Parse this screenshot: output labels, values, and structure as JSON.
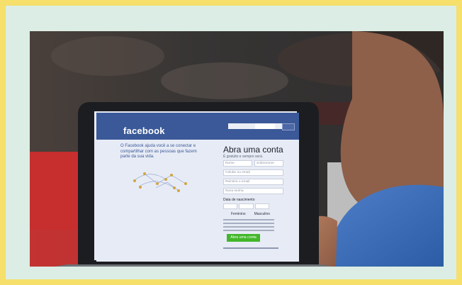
{
  "facebook": {
    "brand": "facebook",
    "intro": "O Facebook ajuda você a se conectar e compartilhar com as pessoas que fazem parte da sua vida.",
    "signup_title": "Abra uma conta",
    "signup_subtitle": "É gratuito e sempre será.",
    "fields": [
      "Nome",
      "Sobrenome",
      "Celular ou email",
      "Reinsira o email",
      "Nova senha"
    ],
    "birth_label": "Data de nascimento",
    "gender": [
      "Feminino",
      "Masculino"
    ],
    "cta": "Abra uma conta"
  },
  "colors": {
    "outer_border": "#f6df6b",
    "inner_panel": "#dbede4",
    "facebook_blue": "#3b5998",
    "signup_green": "#42b72a"
  }
}
